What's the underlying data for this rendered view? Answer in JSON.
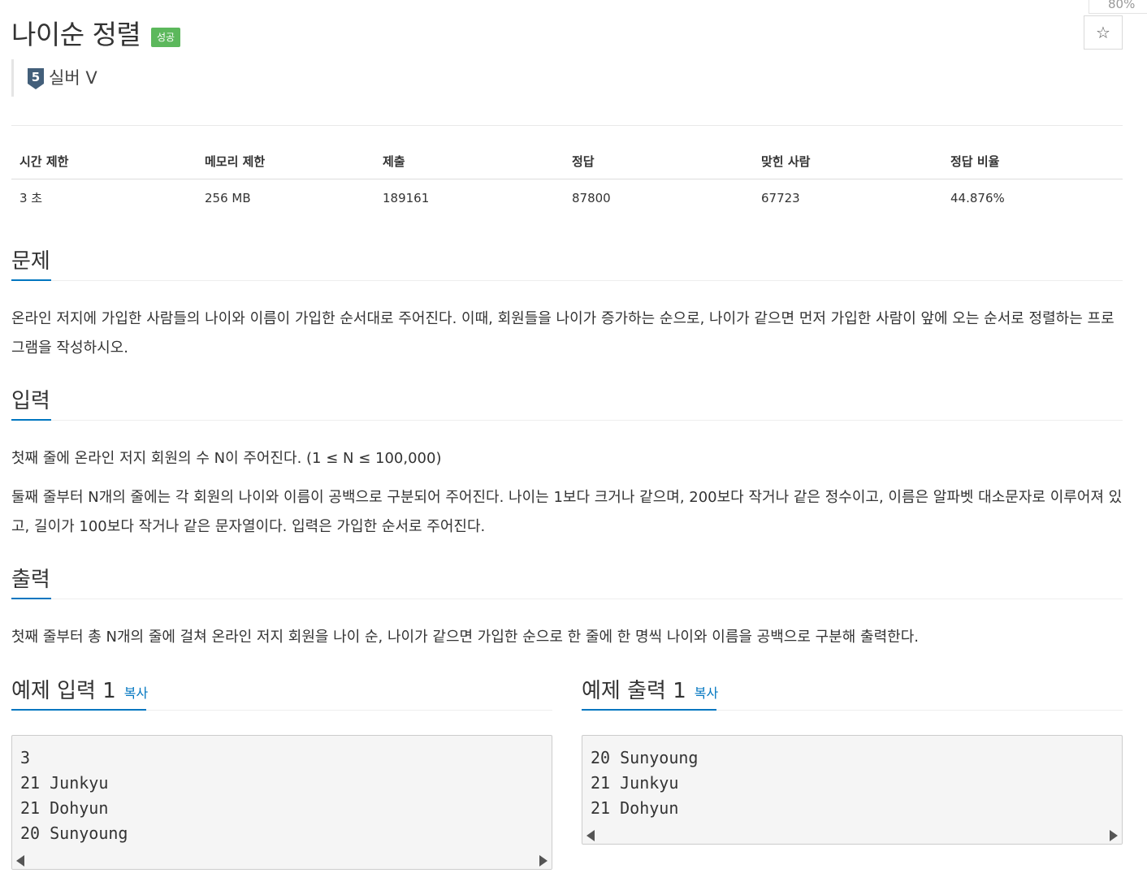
{
  "problem": {
    "title": "나이순 정렬",
    "status_badge": "성공",
    "tier_number": "5",
    "tier_label": "실버 V",
    "zoom": "80%",
    "star_icon": "☆"
  },
  "info_table": {
    "headers": [
      "시간 제한",
      "메모리 제한",
      "제출",
      "정답",
      "맞힌 사람",
      "정답 비율"
    ],
    "values": [
      "3 초",
      "256 MB",
      "189161",
      "87800",
      "67723",
      "44.876%"
    ]
  },
  "sections": {
    "problem": {
      "title": "문제",
      "text": "온라인 저지에 가입한 사람들의 나이와 이름이 가입한 순서대로 주어진다. 이때, 회원들을 나이가 증가하는 순으로, 나이가 같으면 먼저 가입한 사람이 앞에 오는 순서로 정렬하는 프로그램을 작성하시오."
    },
    "input": {
      "title": "입력",
      "p1": "첫째 줄에 온라인 저지 회원의 수 N이 주어진다. (1 ≤ N ≤ 100,000)",
      "p2": "둘째 줄부터 N개의 줄에는 각 회원의 나이와 이름이 공백으로 구분되어 주어진다. 나이는 1보다 크거나 같으며, 200보다 작거나 같은 정수이고, 이름은 알파벳 대소문자로 이루어져 있고, 길이가 100보다 작거나 같은 문자열이다. 입력은 가입한 순서로 주어진다."
    },
    "output": {
      "title": "출력",
      "text": "첫째 줄부터 총 N개의 줄에 걸쳐 온라인 저지 회원을 나이 순, 나이가 같으면 가입한 순으로 한 줄에 한 명씩 나이와 이름을 공백으로 구분해 출력한다."
    }
  },
  "samples": {
    "input": {
      "title": "예제 입력 1",
      "copy": "복사",
      "content": "3\n21 Junkyu\n21 Dohyun\n20 Sunyoung"
    },
    "output": {
      "title": "예제 출력 1",
      "copy": "복사",
      "content": "20 Sunyoung\n21 Junkyu\n21 Dohyun"
    }
  },
  "colors": {
    "accent": "#0076c0",
    "success": "#5cb85c",
    "tier_silver": "#435f7a"
  }
}
